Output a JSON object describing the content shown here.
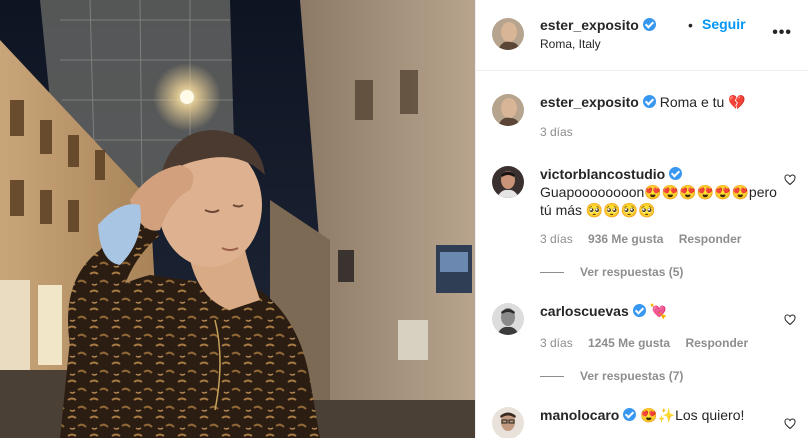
{
  "post": {
    "username": "ester_exposito",
    "follow_label": "Seguir",
    "separator": "•",
    "location": "Roma, Italy",
    "more_label": "•••"
  },
  "caption": {
    "username": "ester_exposito",
    "text": "Roma e tu 💔",
    "time": "3 días"
  },
  "comments": [
    {
      "username": "victorblancostudio",
      "verified": true,
      "text_line1": "Guapoooooooon😍😍😍😍😍😍pero",
      "text_line2": "tú más 🥺🥺🥺🥺",
      "time": "3 días",
      "likes": "936 Me gusta",
      "reply_label": "Responder",
      "view_replies": "Ver respuestas (5)"
    },
    {
      "username": "carloscuevas",
      "verified": true,
      "text_line1": "💘",
      "time": "3 días",
      "likes": "1245 Me gusta",
      "reply_label": "Responder",
      "view_replies": "Ver respuestas (7)"
    },
    {
      "username": "manolocaro",
      "verified": true,
      "text_line1": "😍✨Los quiero!"
    }
  ],
  "icons": {
    "verified": "verified-badge-icon",
    "like": "heart-outline-icon",
    "more": "more-options-icon"
  },
  "colors": {
    "accent": "#0095f6",
    "verified": "#3897f0",
    "muted": "#8e8e8e"
  }
}
